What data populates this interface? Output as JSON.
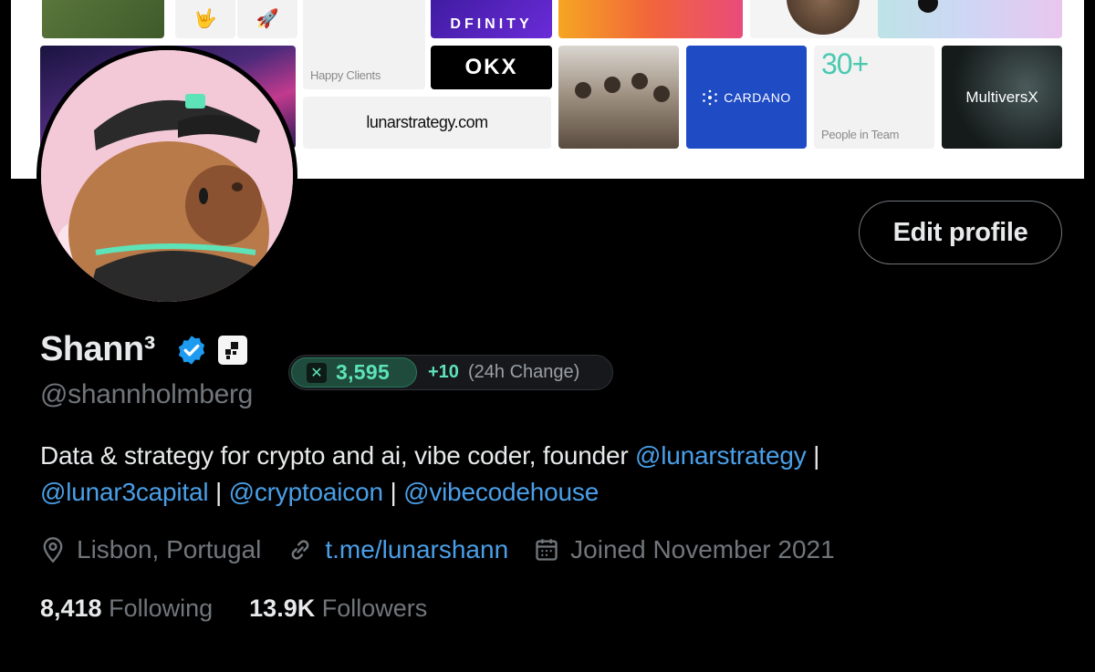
{
  "banner": {
    "happy_clients": "Happy Clients",
    "dfinity": "DFINITY",
    "okx": "OKX",
    "website": "lunarstrategy.com",
    "cardano": "CARDANO",
    "team_count": "30+",
    "team_label": "People in Team",
    "multiversx": "MultiversX"
  },
  "profile": {
    "name": "Shann³",
    "handle": "@shannholmberg",
    "edit_label": "Edit profile"
  },
  "score": {
    "value": "3,595",
    "change": "+10",
    "note": "(24h Change)"
  },
  "bio": {
    "text": "Data & strategy for crypto and ai, vibe coder, founder ",
    "mention1": "@lunarstrategy",
    "sep": " |",
    "mention2": "@lunar3capital",
    "sep2": " | ",
    "mention3": "@cryptoaicon",
    "sep3": " | ",
    "mention4": "@vibecodehouse"
  },
  "meta": {
    "location": "Lisbon, Portugal",
    "link": "t.me/lunarshann",
    "joined": "Joined November 2021"
  },
  "counts": {
    "following_num": "8,418",
    "following_label": "Following",
    "followers_num": "13.9K",
    "followers_label": "Followers"
  },
  "colors": {
    "accent": "#4a9fe8",
    "score_green": "#5ee3b8",
    "muted": "#71767b"
  }
}
